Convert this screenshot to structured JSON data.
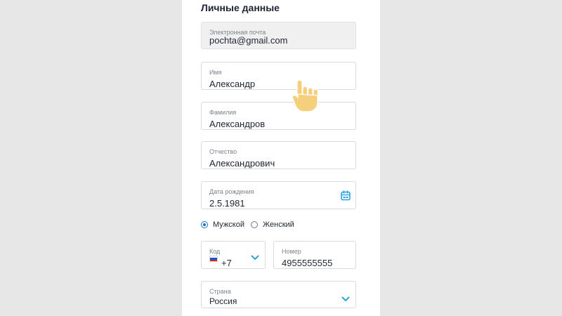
{
  "section": {
    "title": "Личные данные"
  },
  "email": {
    "label": "Электронная почта",
    "value": "pochta@gmail.com"
  },
  "first_name": {
    "label": "Имя",
    "value": "Александр"
  },
  "last_name": {
    "label": "Фамилия",
    "value": "Александров"
  },
  "patronymic": {
    "label": "Отчество",
    "value": "Александрович"
  },
  "birth_date": {
    "label": "Дата рождения",
    "value": "2.5.1981",
    "icon": "calendar-icon"
  },
  "gender": {
    "options": [
      {
        "label": "Мужской",
        "selected": true
      },
      {
        "label": "Женский",
        "selected": false
      }
    ]
  },
  "phone_code": {
    "label": "Код",
    "value": "+7",
    "flag": "russia-flag-icon",
    "icon": "chevron-down-icon"
  },
  "phone_number": {
    "label": "Номер",
    "value": "4955555555"
  },
  "country": {
    "label": "Страна",
    "value": "Россия",
    "icon": "chevron-down-icon"
  },
  "colors": {
    "accent": "#1b73c8",
    "icon_blue": "#2aa3e0",
    "hand": "#f6cf7d"
  }
}
